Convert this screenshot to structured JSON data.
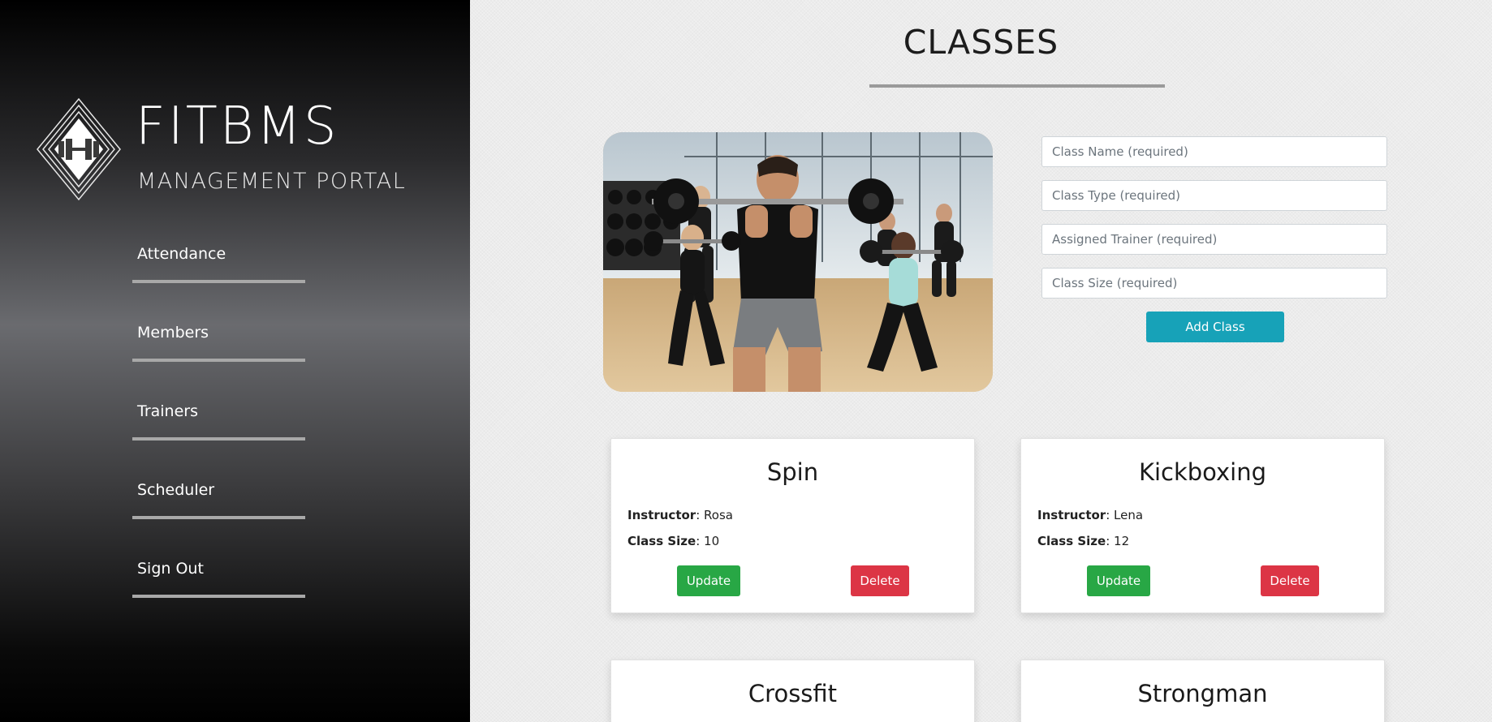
{
  "brand": {
    "title": "FITBMS",
    "subtitle": "MANAGEMENT PORTAL",
    "logo_icon": "dumbbell-icon"
  },
  "sidebar": {
    "items": [
      {
        "label": "Attendance"
      },
      {
        "label": "Members"
      },
      {
        "label": "Trainers"
      },
      {
        "label": "Scheduler"
      },
      {
        "label": "Sign Out"
      }
    ]
  },
  "page": {
    "title": "CLASSES"
  },
  "hero": {
    "image": "gym-squat-class-photo"
  },
  "form": {
    "class_name_placeholder": "Class Name (required)",
    "class_type_placeholder": "Class Type (required)",
    "trainer_placeholder": "Assigned Trainer (required)",
    "class_size_placeholder": "Class Size (required)",
    "submit_label": "Add Class"
  },
  "labels": {
    "instructor": "Instructor",
    "class_size": "Class Size",
    "update": "Update",
    "delete": "Delete"
  },
  "classes": [
    {
      "name": "Spin",
      "instructor": "Rosa",
      "size": "10"
    },
    {
      "name": "Kickboxing",
      "instructor": "Lena",
      "size": "12"
    },
    {
      "name": "Crossfit"
    },
    {
      "name": "Strongman"
    }
  ],
  "colors": {
    "accent_info": "#17a2b8",
    "update_green": "#28a745",
    "delete_red": "#dc3545"
  }
}
